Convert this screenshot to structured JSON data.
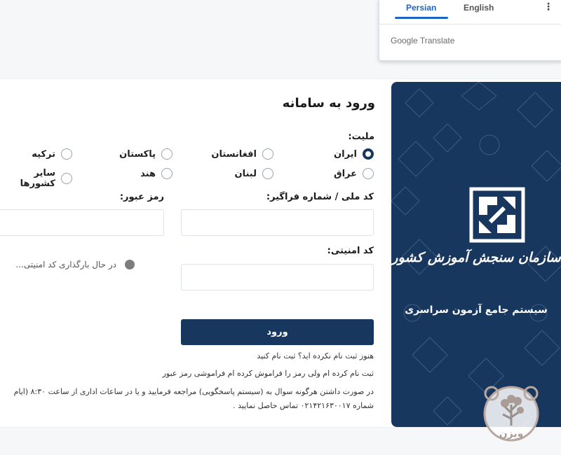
{
  "translate": {
    "tab_persian": "Persian",
    "tab_english": "English",
    "menu_icon": "⋮",
    "brand": "Google Translate"
  },
  "login": {
    "title": "ورود به سامانه",
    "nationality_label": "ملیت:",
    "nationalities": [
      "ایران",
      "افغانستان",
      "پاکستان",
      "ترکیه",
      "عراق",
      "لبنان",
      "هند",
      "سایر کشورها"
    ],
    "selected_nationality": "ایران",
    "national_code_label": "کد ملی / شماره فراگیر:",
    "national_code_value": "",
    "password_label": "رمز عبور:",
    "password_value": "",
    "security_code_label": "کد امنیتی:",
    "security_code_value": "",
    "captcha_loading": "در حال بارگذاری کد امنیتی...",
    "submit_label": "ورود",
    "register_line": "هنوز ثبت نام نکرده اید؟  ثبت نام کنید",
    "forgot_line": "ثبت نام کرده ام ولی رمز را فراموش کرده ام  فراموشی رمز عبور",
    "support_line1": "در صورت داشتن هرگونه سوال به (سیستم پاسخگویی) مراجعه فرمایید و یا در ساعات اداری از ساعت ۸:۳۰ (ایام",
    "support_line2": "شماره ۰۲۱۴۲۱۶۳۰۰۱۷ تماس حاصل نمایید ."
  },
  "brand": {
    "org_name": "سازمان سنجش آموزش کشور",
    "system_name": "سیستم جامع آزمون سراسری",
    "logo_icon": "sanjesh-logo",
    "color": "#17375e"
  },
  "watermark": {
    "icon": "tree-watermark",
    "text": "ویزن"
  }
}
